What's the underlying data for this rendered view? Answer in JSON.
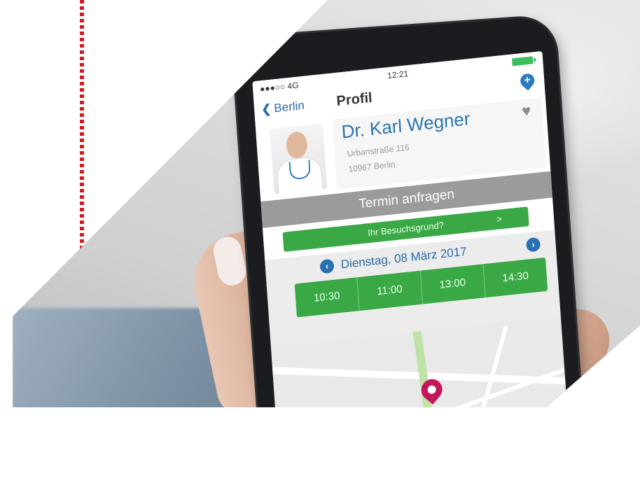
{
  "status_bar": {
    "carrier": "●●●○○ 4G",
    "time": "12:21"
  },
  "nav": {
    "back_label": "Berlin",
    "title": "Profil"
  },
  "doctor": {
    "name": "Dr. Karl Wegner",
    "street": "Urbanstraße 116",
    "city": "10967 Berlin"
  },
  "section_title": "Termin anfragen",
  "reason_button": {
    "label": "Ihr Besuchsgrund?",
    "arrow": ">"
  },
  "date": {
    "label": "Dienstag, 08 März 2017"
  },
  "time_slots": [
    "10:30",
    "11:00",
    "13:00",
    "14:30"
  ],
  "icons": {
    "back": "chevron-left-icon",
    "add_favorite": "pin-plus-icon",
    "favorite": "heart-icon",
    "prev": "chevron-left-circle-icon",
    "next": "chevron-right-circle-icon",
    "map_pin": "map-pin-icon"
  },
  "colors": {
    "accent_blue": "#2a75b0",
    "green": "#3aa845",
    "red_line": "#d71920",
    "map_pin": "#c2185b",
    "gray_bar": "#9b9b9b"
  }
}
